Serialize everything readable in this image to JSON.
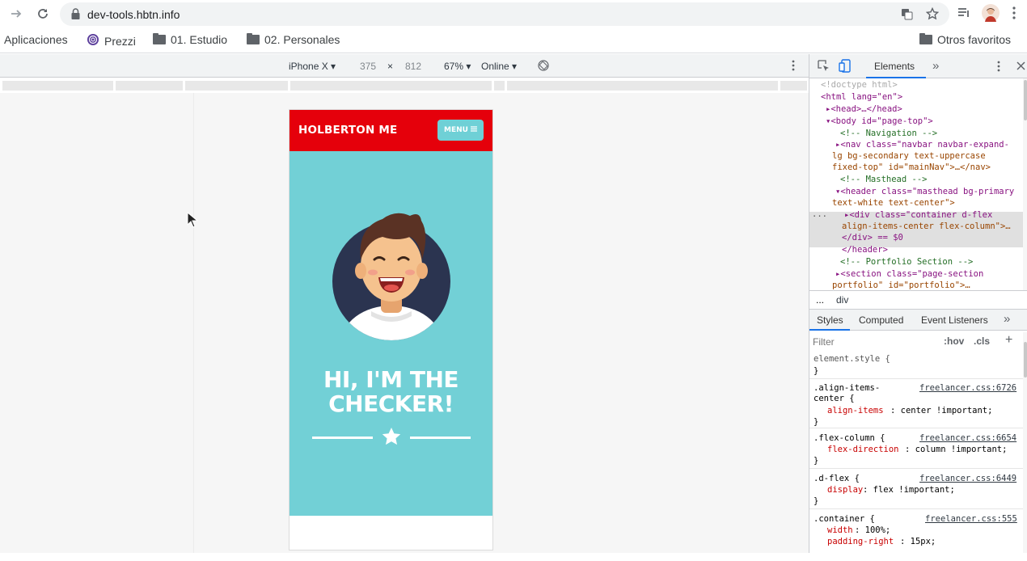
{
  "browser": {
    "url": "dev-tools.hbtn.info",
    "bookmarks": [
      {
        "label": "Aplicaciones",
        "icon": "apps-grid-icon"
      },
      {
        "label": "Prezzi",
        "icon": "prezzi-logo-icon"
      },
      {
        "label": "01. Estudio",
        "icon": "folder-icon"
      },
      {
        "label": "02. Personales",
        "icon": "folder-icon"
      }
    ],
    "other_bookmarks": "Otros favoritos"
  },
  "device_toolbar": {
    "device": "iPhone X",
    "width": "375",
    "times": "×",
    "height": "812",
    "zoom": "67%",
    "network": "Online"
  },
  "site": {
    "brand": "HOLBERTON ME",
    "menu": "MENU",
    "hero_line1": "HI, I'M THE",
    "hero_line2": "CHECKER!",
    "colors": {
      "nav": "#e5000b",
      "masthead": "#72d0d6",
      "menu_btn": "#6fd0d6"
    }
  },
  "devtools": {
    "tabs": {
      "elements": "Elements",
      "more": "»"
    },
    "dom": {
      "doctype": "<!doctype html>",
      "html_open": "<html lang=\"en\">",
      "head": "▸<head>…</head>",
      "body": "▾<body id=\"page-top\">",
      "c_nav": "<!-- Navigation -->",
      "nav1": "▸<nav class=\"navbar navbar-expand-",
      "nav2": "lg bg-secondary text-uppercase",
      "nav3": "fixed-top\" id=\"mainNav\">…</nav>",
      "c_mast": "<!-- Masthead -->",
      "header1": "▾<header class=\"masthead bg-primary",
      "header2": "text-white text-center\">",
      "div1": "▸<div class=\"container d-flex",
      "div2": "align-items-center flex-column\">…",
      "div3": "</div> == $0",
      "header_close": "</header>",
      "c_port": "<!-- Portfolio Section -->",
      "sec1": "▸<section class=\"page-section",
      "sec2": "portfolio\" id=\"portfolio\">…",
      "ellipsis": "..."
    },
    "breadcrumb": {
      "dots": "...",
      "node": "div"
    },
    "styles_tabs": {
      "styles": "Styles",
      "computed": "Computed",
      "listeners": "Event Listeners",
      "more": "»"
    },
    "filter": {
      "placeholder": "Filter",
      "hov": ":hov",
      "cls": ".cls",
      "add": "+"
    },
    "rules": {
      "element_style": "element.style {",
      "close": "}",
      "r1_sel1": ".align-items-",
      "r1_sel2": "center {",
      "r1_src": "freelancer.css:6726",
      "r1_prop": "align-items",
      "r1_val": ": center !important;",
      "r2_sel": ".flex-column {",
      "r2_src": "freelancer.css:6654",
      "r2_prop": "flex-direction",
      "r2_val": ": column !important;",
      "r3_sel": ".d-flex {",
      "r3_src": "freelancer.css:6449",
      "r3_prop": "display",
      "r3_val": ": flex !important;",
      "r4_sel": ".container {",
      "r4_src": "freelancer.css:555",
      "r4_prop1": "width",
      "r4_val1": ": 100%;",
      "r4_prop2": "padding-right",
      "r4_val2": ": 15px;"
    }
  }
}
